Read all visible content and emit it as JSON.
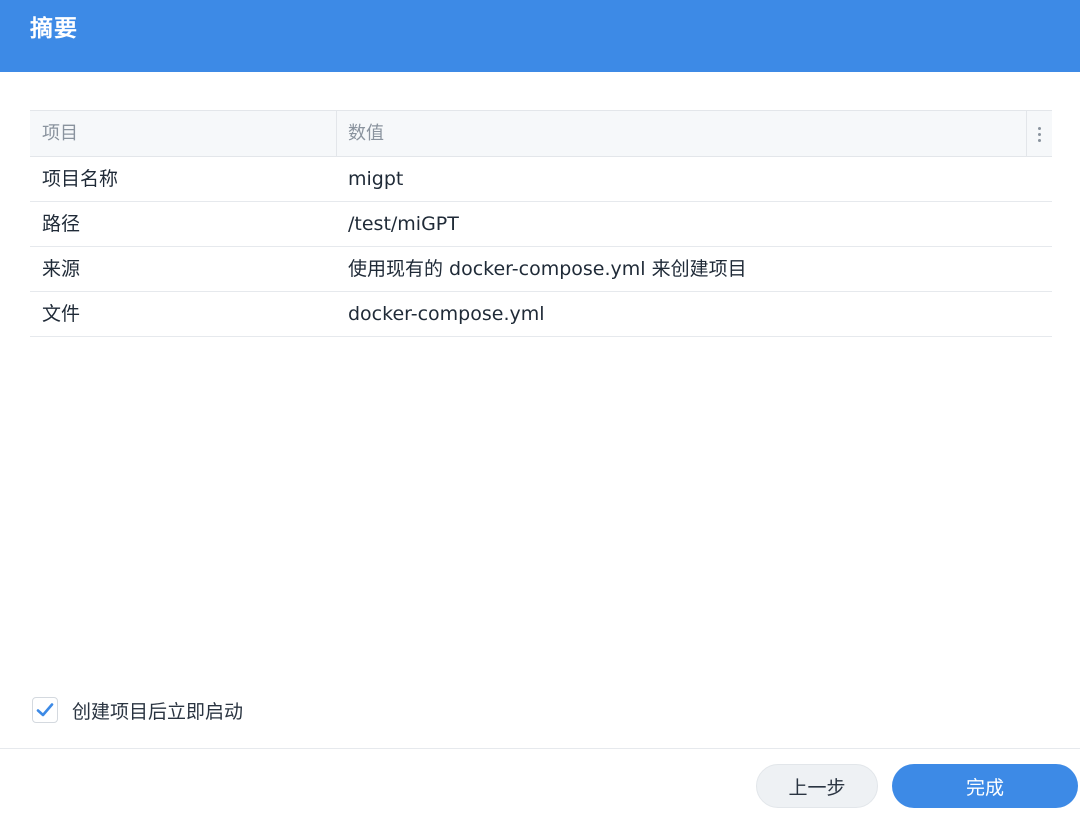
{
  "header": {
    "title": "摘要"
  },
  "table": {
    "columns": {
      "name": "项目",
      "value": "数值"
    },
    "rows": [
      {
        "name": "项目名称",
        "value": "migpt"
      },
      {
        "name": "路径",
        "value": "/test/miGPT"
      },
      {
        "name": "来源",
        "value": "使用现有的 docker-compose.yml 来创建项目"
      },
      {
        "name": "文件",
        "value": "docker-compose.yml"
      }
    ]
  },
  "options": {
    "autostart_label": "创建项目后立即启动",
    "autostart_checked": true
  },
  "footer": {
    "back_label": "上一步",
    "finish_label": "完成"
  },
  "colors": {
    "accent": "#3d8ae6"
  }
}
